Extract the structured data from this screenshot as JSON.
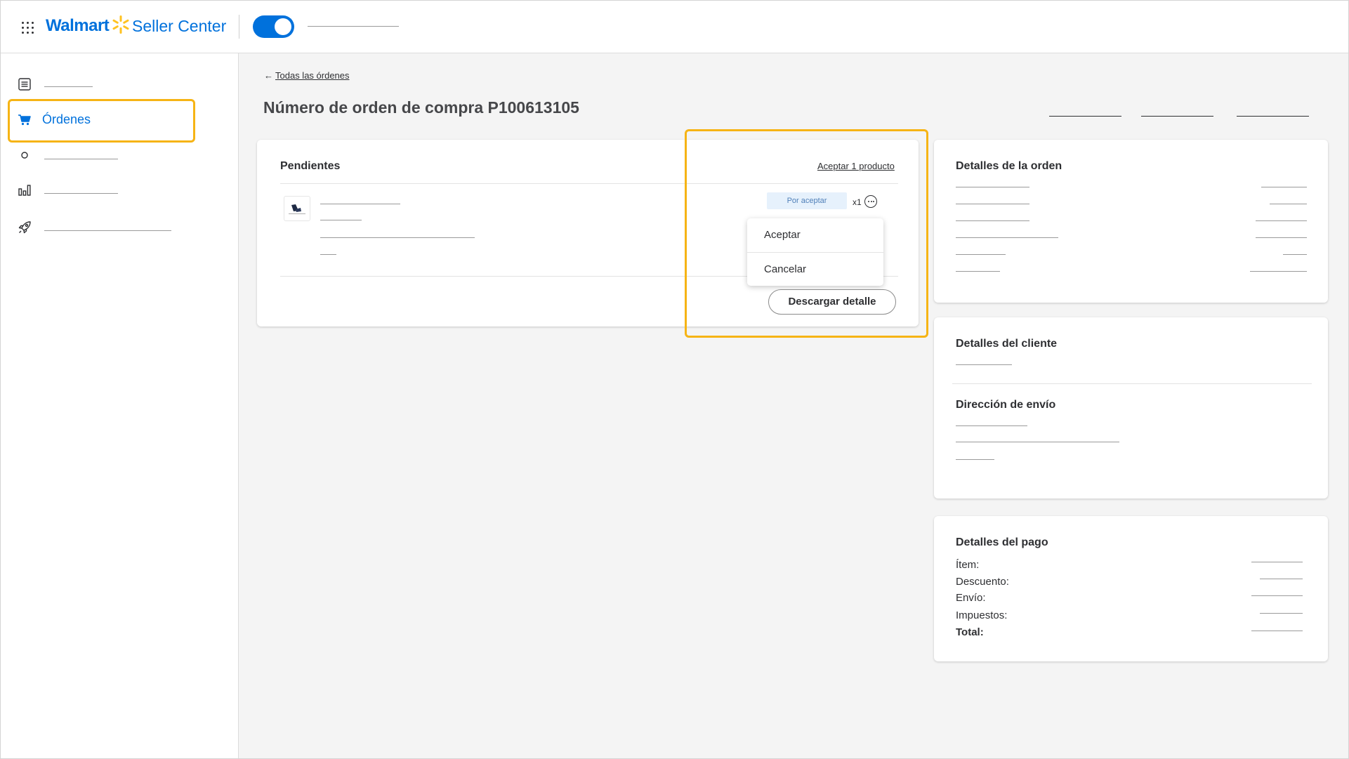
{
  "header": {
    "brand_name": "Walmart",
    "brand_product": "Seller Center",
    "toggle_on": true
  },
  "sidebar": {
    "items": [
      {
        "name": "list-icon",
        "label": ""
      },
      {
        "name": "cart-icon",
        "label": "Órdenes",
        "active": true
      },
      {
        "name": "circle-icon",
        "label": ""
      },
      {
        "name": "bar-chart-icon",
        "label": ""
      },
      {
        "name": "rocket-icon",
        "label": ""
      }
    ]
  },
  "main": {
    "back_arrow": "←",
    "back_link": "Todas las órdenes",
    "title": "Número de orden de compra P100613105",
    "pending_card": {
      "title": "Pendientes",
      "accept_link": "Aceptar 1 producto",
      "status_badge": "Por aceptar",
      "quantity": "x1",
      "menu": {
        "accept": "Aceptar",
        "cancel": "Cancelar"
      },
      "download_button": "Descargar detalle"
    },
    "order_details": {
      "title": "Detalles de la orden"
    },
    "customer_details": {
      "title": "Detalles del cliente",
      "shipping_title": "Dirección de envío"
    },
    "payment_details": {
      "title": "Detalles del pago",
      "item_label": "Ítem:",
      "discount_label": "Descuento:",
      "shipping_label": "Envío:",
      "taxes_label": "Impuestos:",
      "total_label": "Total:"
    }
  },
  "colors": {
    "brand_blue": "#0071dc",
    "brand_yellow": "#ffc220",
    "highlight": "#f6b415",
    "badge_bg": "#e6f1fc"
  }
}
